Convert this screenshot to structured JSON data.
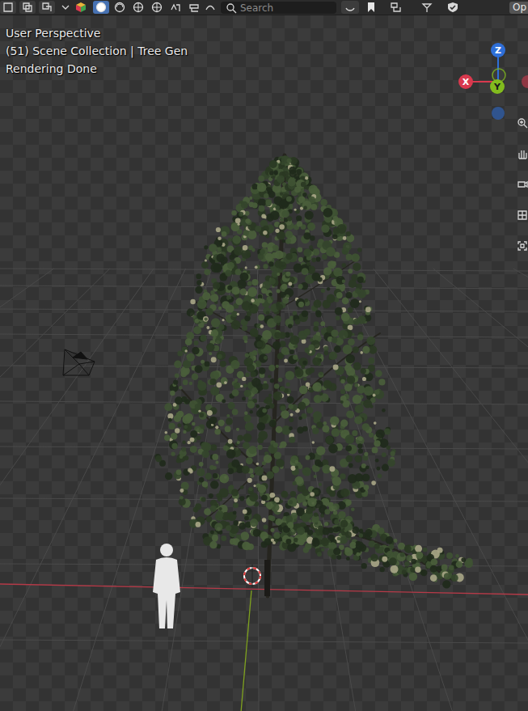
{
  "header": {
    "shading": [
      {
        "selected": true
      },
      {
        "selected": false
      },
      {
        "selected": false
      },
      {
        "selected": false
      }
    ],
    "search": {
      "placeholder": "Search"
    },
    "menu": {
      "label": "Op"
    }
  },
  "viewport": {
    "lines": [
      "User Perspective",
      "(51) Scene Collection | Tree Gen",
      "Rendering Done"
    ]
  },
  "gizmo": {
    "axes": [
      {
        "label": "Z",
        "color": "#2e6fd8"
      },
      {
        "label": "X",
        "color": "#d9394e"
      },
      {
        "label": "Y",
        "color": "#82bb1e"
      }
    ]
  }
}
